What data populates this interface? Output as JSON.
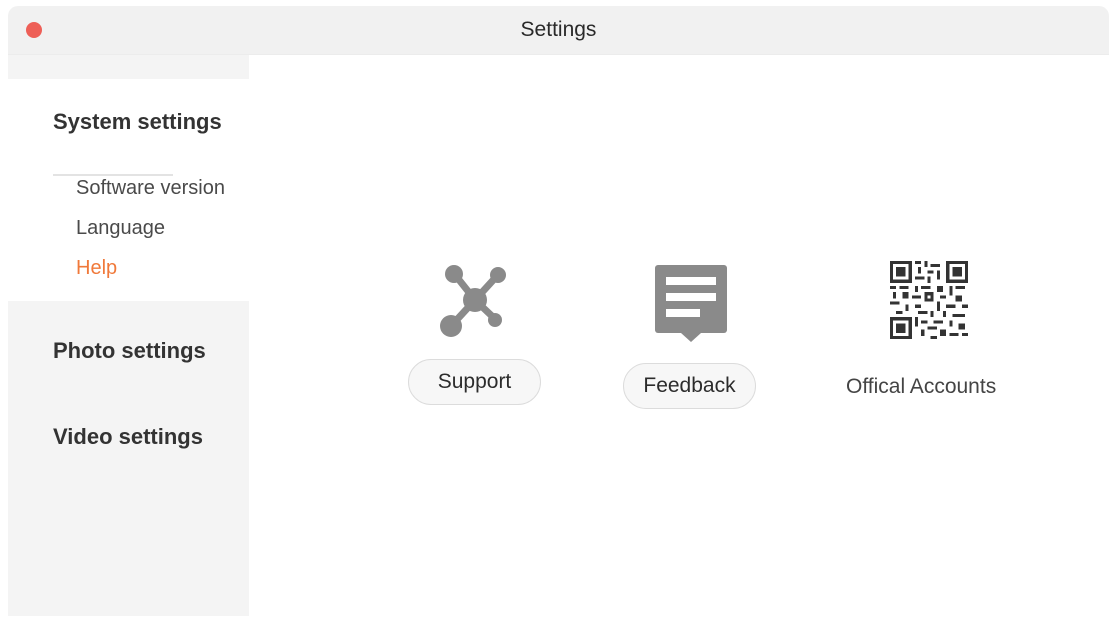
{
  "window": {
    "title": "Settings"
  },
  "sidebar": {
    "system": {
      "title": "System settings",
      "items": [
        {
          "label": "Software version"
        },
        {
          "label": "Language"
        },
        {
          "label": "Help",
          "active": true
        }
      ]
    },
    "photo": {
      "title": "Photo settings"
    },
    "video": {
      "title": "Video settings"
    }
  },
  "help": {
    "support": {
      "label": "Support",
      "icon": "network-nodes-icon"
    },
    "feedback": {
      "label": "Feedback",
      "icon": "feedback-message-icon"
    },
    "official": {
      "label": "Offical Accounts",
      "icon": "qr-code-icon"
    }
  },
  "colors": {
    "accent": "#f0793a",
    "close_button": "#ee5f57",
    "icon_gray": "#8a8a8a"
  }
}
